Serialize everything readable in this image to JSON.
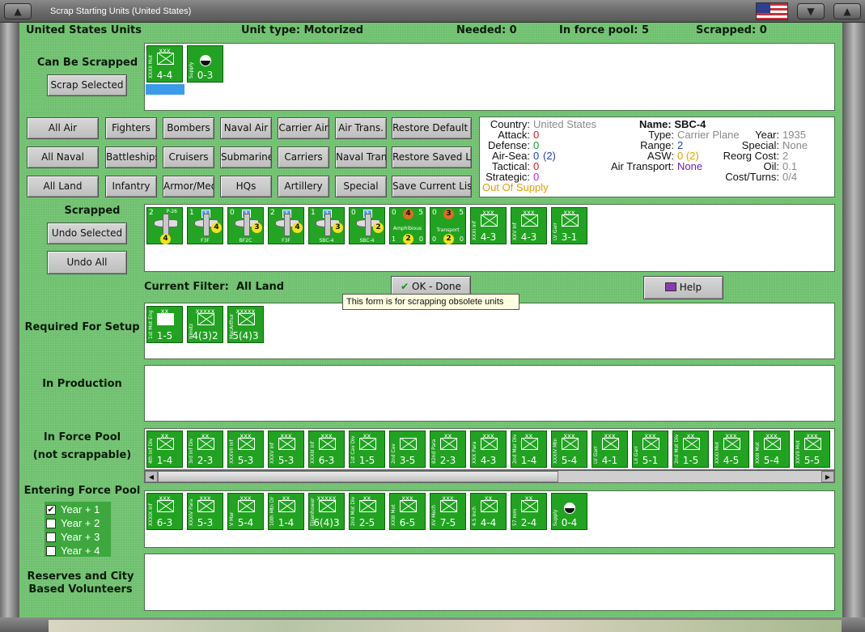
{
  "window": {
    "title": "Scrap Starting Units (United States)",
    "menu_btn": "▲",
    "min_btn": "▼",
    "close_btn": "▲"
  },
  "header": {
    "country_units": "United States Units",
    "unit_type": "Unit type: Motorized",
    "needed": "Needed:  0",
    "in_force_pool": "In force pool:  5",
    "scrapped": "Scrapped:  0"
  },
  "labels": {
    "can_be_scrapped": "Can Be Scrapped",
    "scrapped": "Scrapped",
    "current_filter_label": "Current Filter:",
    "current_filter_value": "All Land",
    "required_for_setup": "Required For Setup",
    "in_production": "In Production",
    "in_force_pool_line1": "In Force Pool",
    "in_force_pool_line2": "(not scrappable)",
    "entering_force_pool": "Entering Force Pool",
    "reserves_line1": "Reserves and City",
    "reserves_line2": "Based Volunteers"
  },
  "buttons": {
    "scrap_selected": "Scrap Selected",
    "undo_selected": "Undo Selected",
    "undo_all": "Undo All",
    "ok_done": "OK - Done",
    "help": "Help"
  },
  "filters": [
    [
      "All Air",
      "Fighters",
      "Bombers",
      "Naval Air",
      "Carrier Air",
      "Air Trans.",
      "Restore Default List"
    ],
    [
      "All Naval",
      "Battleships",
      "Cruisers",
      "Submarines",
      "Carriers",
      "Naval Trans.",
      "Restore Saved List"
    ],
    [
      "All Land",
      "Infantry",
      "Armor/Mech",
      "HQs",
      "Artillery",
      "Special",
      "Save Current List"
    ]
  ],
  "tooltip": "This form is for scrapping obsolete units",
  "info": {
    "country_label": "Country:",
    "country_value": "United States",
    "attack_label": "Attack:",
    "attack_value": "0",
    "defense_label": "Defense:",
    "defense_value": "0",
    "airsea_label": "Air-Sea:",
    "airsea_value": "0",
    "airsea_paren": "(2)",
    "tactical_label": "Tactical:",
    "tactical_value": "0",
    "strategic_label": "Strategic:",
    "strategic_value": "0",
    "supply_status": "Out Of Supply",
    "name": "Name: SBC-4",
    "type_label": "Type:",
    "type_value": "Carrier Plane",
    "range_label": "Range:",
    "range_value": "2",
    "asw_label": "ASW:",
    "asw_value": "0 (2)",
    "air_transport_label": "Air Transport:",
    "air_transport_value": "None",
    "year_label": "Year:",
    "year_value": "1935",
    "special_label": "Special:",
    "special_value": "None",
    "reorg_label": "Reorg Cost:",
    "reorg_value": "2",
    "oil_label": "Oil:",
    "oil_value": "0.1",
    "cost_label": "Cost/Turns:",
    "cost_value": "0/4"
  },
  "colors": {
    "panel": "#6fbf6f",
    "counter": "#21a321",
    "selected": "#3b9bea",
    "attack": "#e0141e",
    "defense": "#1a9c2a",
    "airsea": "#2040c0",
    "strategic": "#d020d0",
    "supply": "#e0a000"
  },
  "can_be_scrapped_units": [
    {
      "size": "xxx",
      "name": "XXXII Mot",
      "str": "4-4"
    },
    {
      "size": "",
      "name": "Supply",
      "str": "0-3"
    }
  ],
  "scrapped_air": [
    {
      "tl": "2",
      "tag": "P-26",
      "circle": "4",
      "bl": "",
      "br": ""
    },
    {
      "tl": "1",
      "tag": "1",
      "circle": "4",
      "bl": "",
      "br": "F3F"
    },
    {
      "tl": "0",
      "tag": "1",
      "circle": "3",
      "bl": "",
      "br": "BF2C"
    },
    {
      "tl": "2",
      "tag": "1",
      "circle": "4",
      "bl": "",
      "br": "F3F"
    },
    {
      "tl": "1",
      "tag": "1",
      "circle": "3",
      "bl": "",
      "br": "SBC-4"
    },
    {
      "tl": "0",
      "tag": "1",
      "circle": "2",
      "bl": "",
      "br": "SBC-4"
    }
  ],
  "scrapped_transport": [
    {
      "tl": "0",
      "top": "4",
      "tr": "5",
      "name": "Amphibious",
      "bl": "1",
      "circle": "2",
      "br": "0"
    },
    {
      "tl": "0",
      "top": "3",
      "tr": "5",
      "name": "Transport",
      "bl": "0",
      "circle": "2",
      "br": "0"
    }
  ],
  "scrapped_land": [
    {
      "size": "xxx",
      "name": "XXXI Inf",
      "str": "4-3"
    },
    {
      "size": "xxx",
      "name": "XXV Inf",
      "str": "4-3"
    },
    {
      "size": "xxx",
      "name": "LV Garr",
      "str": "3-1"
    }
  ],
  "required_units": [
    {
      "size": "xx",
      "name": "1st Mot Eng",
      "str": "1-5"
    },
    {
      "size": "xxxxx",
      "name": "Nimitz",
      "str": "4(3)2"
    },
    {
      "size": "xxxxx",
      "name": "MacArthur",
      "str": "5(4)3"
    }
  ],
  "force_pool_units": [
    {
      "size": "xx",
      "name": "4th Inf Div",
      "str": "1-4"
    },
    {
      "size": "xx",
      "name": "3rd Inf Div",
      "str": "2-3"
    },
    {
      "size": "xxx",
      "name": "XXXVII Inf",
      "str": "5-3"
    },
    {
      "size": "xxx",
      "name": "XXXV Inf",
      "str": "5-3"
    },
    {
      "size": "xxx",
      "name": "XXXIII Inf",
      "str": "6-3"
    },
    {
      "size": "xx",
      "name": "1st Cav Div",
      "str": "1-5"
    },
    {
      "size": "",
      "name": "2nd Cav",
      "str": "3-5"
    },
    {
      "size": "xx",
      "name": "82nd Para",
      "str": "2-3"
    },
    {
      "size": "xxx",
      "name": "XXX Para",
      "str": "4-3"
    },
    {
      "size": "xx",
      "name": "2nd Mar Div",
      "str": "1-4"
    },
    {
      "size": "xxx",
      "name": "XXXIV Mtn",
      "str": "5-4"
    },
    {
      "size": "xxx",
      "name": "LV Garr",
      "str": "4-1"
    },
    {
      "size": "xxx",
      "name": "LII Garr",
      "str": "5-1"
    },
    {
      "size": "xx",
      "name": "2nd Mot Div",
      "str": "1-5"
    },
    {
      "size": "xxx",
      "name": "XXXI Mot",
      "str": "4-5"
    },
    {
      "size": "xxx",
      "name": "XXIII Mot",
      "str": "5-4"
    },
    {
      "size": "xxx",
      "name": "XXVII Mot",
      "str": "5-5"
    }
  ],
  "entering_units": [
    {
      "size": "xxx",
      "name": "XXXIX Inf",
      "str": "6-3"
    },
    {
      "size": "xxx",
      "name": "XXXIV Para",
      "str": "5-3"
    },
    {
      "size": "xxx",
      "name": "V Mar",
      "str": "5-4"
    },
    {
      "size": "xx",
      "name": "10th Mtn Div",
      "str": "1-4"
    },
    {
      "size": "xxxxx",
      "name": "Eisenhower",
      "str": "6(4)3"
    },
    {
      "size": "xx",
      "name": "2nd Mot Div",
      "str": "2-5"
    },
    {
      "size": "xxx",
      "name": "XXIII Mot",
      "str": "6-5"
    },
    {
      "size": "xxx",
      "name": "XV Mech",
      "str": "7-5"
    },
    {
      "size": "xx",
      "name": "4.5 inch",
      "str": "4-4"
    },
    {
      "size": "xx",
      "name": "57 mm",
      "str": "2-4"
    },
    {
      "size": "",
      "name": "Supply",
      "str": "0-4"
    }
  ],
  "years": [
    {
      "label": "Year + 1",
      "checked": "✔"
    },
    {
      "label": "Year + 2",
      "checked": ""
    },
    {
      "label": "Year + 3",
      "checked": ""
    },
    {
      "label": "Year + 4",
      "checked": ""
    }
  ]
}
